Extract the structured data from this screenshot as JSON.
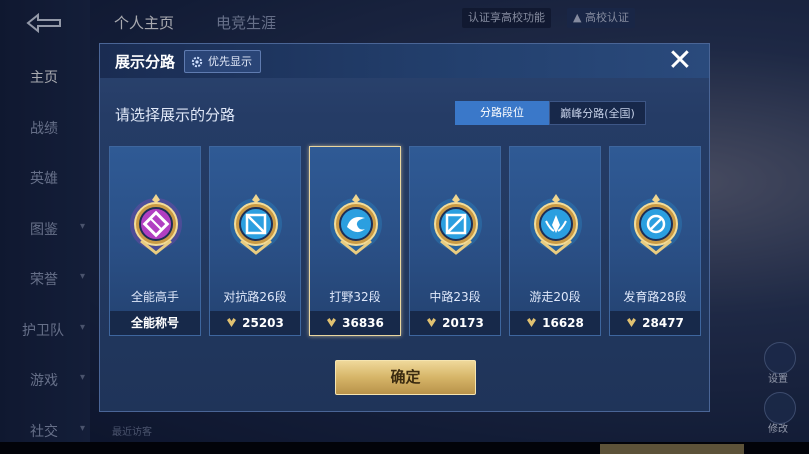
{
  "background": {
    "sidebar": {
      "items": [
        {
          "label": "主页",
          "active": true
        },
        {
          "label": "战绩"
        },
        {
          "label": "英雄"
        },
        {
          "label": "图鉴"
        },
        {
          "label": "荣誉"
        },
        {
          "label": "护卫队"
        },
        {
          "label": "游戏"
        },
        {
          "label": "社交"
        }
      ]
    },
    "top_tabs": [
      "个人主页",
      "电竞生涯"
    ],
    "top_right": {
      "verify_text": "认证享高校功能",
      "campus_badge": "高校认证"
    },
    "recent_visits": "最近访客",
    "right_buttons": [
      "设置",
      "修改"
    ]
  },
  "modal": {
    "title": "展示分路",
    "priority_button": "优先显示",
    "prompt": "请选择展示的分路",
    "mode_options": [
      "分路段位",
      "巅峰分路(全国)"
    ],
    "active_mode": "分路段位",
    "cards": [
      {
        "name": "全能高手",
        "footer": "全能称号",
        "has_rank_icon": false,
        "selected": false,
        "badge_color": "#b13fc2",
        "icon": "all-round-icon"
      },
      {
        "name": "对抗路26段",
        "footer": "25203",
        "has_rank_icon": true,
        "selected": false,
        "badge_color": "#2b9fe0",
        "icon": "clash-lane-icon"
      },
      {
        "name": "打野32段",
        "footer": "36836",
        "has_rank_icon": true,
        "selected": true,
        "badge_color": "#2b9fe0",
        "icon": "jungle-icon"
      },
      {
        "name": "中路23段",
        "footer": "20173",
        "has_rank_icon": true,
        "selected": false,
        "badge_color": "#2b9fe0",
        "icon": "mid-lane-icon"
      },
      {
        "name": "游走20段",
        "footer": "16628",
        "has_rank_icon": true,
        "selected": false,
        "badge_color": "#2b9fe0",
        "icon": "roam-icon"
      },
      {
        "name": "发育路28段",
        "footer": "28477",
        "has_rank_icon": true,
        "selected": false,
        "badge_color": "#2b9fe0",
        "icon": "farm-lane-icon"
      }
    ],
    "confirm_button": "确定",
    "close_icon": "close-icon"
  }
}
